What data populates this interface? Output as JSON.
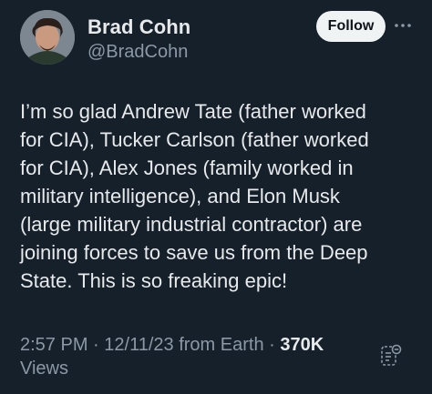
{
  "author": {
    "display_name": "Brad Cohn",
    "handle": "@BradCohn"
  },
  "follow_button": {
    "label": "Follow"
  },
  "tweet": {
    "text": "I’m so glad Andrew Tate (father worked\nfor CIA), Tucker Carlson (father worked\nfor CIA), Alex Jones (family worked in\nmilitary intelligence),  and Elon Musk\n(large military industrial contractor) are\njoining forces to save us from the Deep\nState.  This is so freaking epic!",
    "time": "2:57 PM",
    "date": "12/11/23",
    "location": "from Earth",
    "separator": " · ",
    "views_count": "370K",
    "views_label": "Views"
  },
  "icons": {
    "more": "more-horizontal-icon",
    "share": "analytics-icon"
  },
  "colors": {
    "background": "#15202b",
    "text_primary": "#e7e9ea",
    "text_secondary": "#8b98a5",
    "follow_bg": "#eff3f4"
  }
}
